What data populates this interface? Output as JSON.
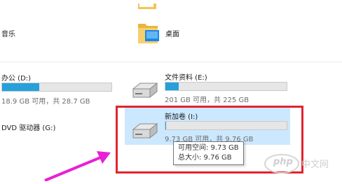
{
  "items": {
    "music": {
      "label": "音乐"
    },
    "desktop": {
      "label": "桌面"
    }
  },
  "drives": [
    {
      "name": "办公 (D:)",
      "free_text": "18.9 GB 可用，共 28.7 GB",
      "used_fraction": 0.34
    },
    {
      "name": "文件资料 (E:)",
      "free_text": "201 GB 可用，共 225 GB",
      "used_fraction": 0.107
    },
    {
      "name": "DVD 驱动器 (G:)"
    },
    {
      "name": "新加卷 (I:)",
      "free_text": "9.73 GB 可用，共 9.76 GB",
      "used_fraction": 0.003
    }
  ],
  "tooltip": {
    "line1": "可用空间: 9.73 GB",
    "line2": "总大小: 9.76 GB"
  },
  "watermark": {
    "text": "php",
    "suffix": "中文网"
  },
  "colors": {
    "bar": "#26a0da",
    "highlight": "#cce8ff",
    "redbox": "#e0242e",
    "arrow": "#e81fd7"
  }
}
